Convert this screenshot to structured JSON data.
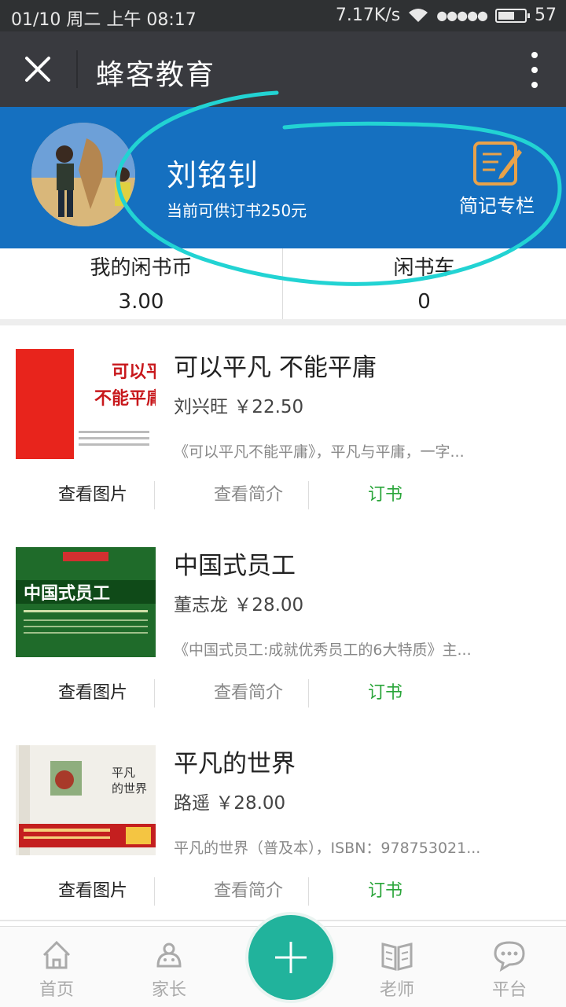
{
  "status_bar": {
    "datetime": "01/10 周二 上午 08:17",
    "speed": "7.17K/s",
    "battery": "57",
    "signal_dots": "●●●●●"
  },
  "app": {
    "title": "蜂客教育"
  },
  "profile": {
    "name": "刘铭钊",
    "credit": "当前可供订书250元",
    "notes_label": "简记专栏"
  },
  "stats": [
    {
      "label": "我的闲书币",
      "value": "3.00"
    },
    {
      "label": "闲书车",
      "value": "0"
    }
  ],
  "books": [
    {
      "title": "可以平凡 不能平庸",
      "author_price": "刘兴旺 ￥22.50",
      "desc": "《可以平凡不能平庸》，平凡与平庸，一字...",
      "cover_text": "可以平凡\n不能平庸"
    },
    {
      "title": "中国式员工",
      "author_price": "董志龙 ￥28.00",
      "desc": "《中国式员工:成就优秀员工的6大特质》主...",
      "cover_text": "中国式员工"
    },
    {
      "title": "平凡的世界",
      "author_price": "路遥 ￥28.00",
      "desc": "平凡的世界（普及本），ISBN：978753021...",
      "cover_text": "平凡的世界"
    }
  ],
  "actions": {
    "view_images": "查看图片",
    "view_intro": "查看简介",
    "order": "订书"
  },
  "nav": {
    "items": [
      "首页",
      "家长",
      "老师",
      "平台"
    ]
  },
  "colors": {
    "banner": "#1570c0",
    "order_green": "#2aa53a",
    "fab": "#21b39c",
    "annotation": "#22d3d3"
  }
}
